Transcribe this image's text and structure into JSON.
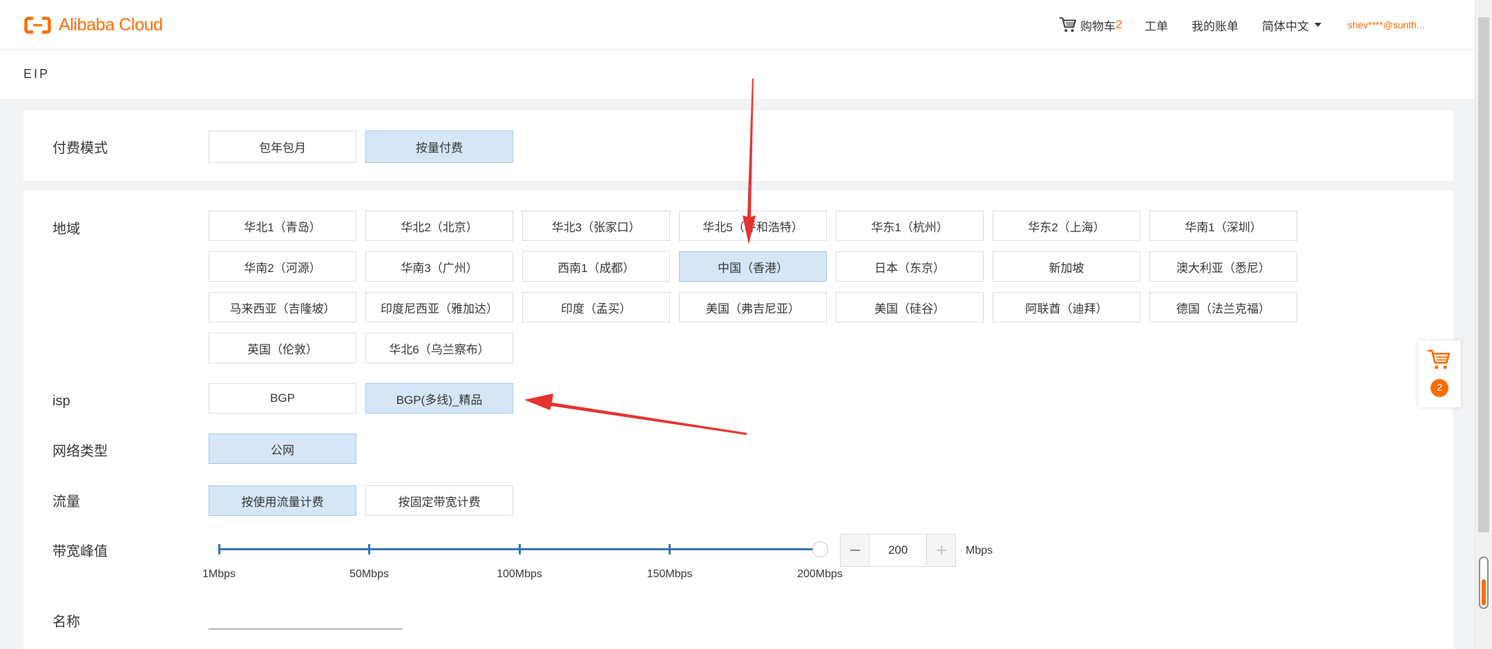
{
  "header": {
    "logo_text": "Alibaba Cloud",
    "cart_label": "购物车",
    "cart_count": "2",
    "ticket_label": "工单",
    "billing_label": "我的账单",
    "language_label": "简体中文",
    "user_label": "shev****@sunth..."
  },
  "page": {
    "title": "EIP"
  },
  "form": {
    "billing_mode": {
      "label": "付费模式",
      "options": [
        {
          "label": "包年包月",
          "selected": false
        },
        {
          "label": "按量付费",
          "selected": true
        }
      ]
    },
    "region": {
      "label": "地域",
      "options": [
        {
          "label": "华北1（青岛）",
          "selected": false
        },
        {
          "label": "华北2（北京）",
          "selected": false
        },
        {
          "label": "华北3（张家口）",
          "selected": false
        },
        {
          "label": "华北5（呼和浩特）",
          "selected": false
        },
        {
          "label": "华东1（杭州）",
          "selected": false
        },
        {
          "label": "华东2（上海）",
          "selected": false
        },
        {
          "label": "华南1（深圳）",
          "selected": false
        },
        {
          "label": "华南2（河源）",
          "selected": false
        },
        {
          "label": "华南3（广州）",
          "selected": false
        },
        {
          "label": "西南1（成都）",
          "selected": false
        },
        {
          "label": "中国（香港）",
          "selected": true
        },
        {
          "label": "日本（东京）",
          "selected": false
        },
        {
          "label": "新加坡",
          "selected": false
        },
        {
          "label": "澳大利亚（悉尼）",
          "selected": false
        },
        {
          "label": "马来西亚（吉隆坡）",
          "selected": false
        },
        {
          "label": "印度尼西亚（雅加达）",
          "selected": false
        },
        {
          "label": "印度（孟买）",
          "selected": false
        },
        {
          "label": "美国（弗吉尼亚）",
          "selected": false
        },
        {
          "label": "美国（硅谷）",
          "selected": false
        },
        {
          "label": "阿联酋（迪拜）",
          "selected": false
        },
        {
          "label": "德国（法兰克福）",
          "selected": false
        },
        {
          "label": "英国（伦敦）",
          "selected": false
        },
        {
          "label": "华北6（乌兰察布）",
          "selected": false
        }
      ]
    },
    "isp": {
      "label": "isp",
      "options": [
        {
          "label": "BGP",
          "selected": false
        },
        {
          "label": "BGP(多线)_精品",
          "selected": true
        }
      ]
    },
    "network_type": {
      "label": "网络类型",
      "options": [
        {
          "label": "公网",
          "selected": true
        }
      ]
    },
    "traffic": {
      "label": "流量",
      "options": [
        {
          "label": "按使用流量计费",
          "selected": true
        },
        {
          "label": "按固定带宽计费",
          "selected": false
        }
      ]
    },
    "bandwidth": {
      "label": "带宽峰值",
      "marks": [
        "1Mbps",
        "50Mbps",
        "100Mbps",
        "150Mbps",
        "200Mbps"
      ],
      "min": 1,
      "max": 200,
      "value": "200",
      "unit": "Mbps"
    },
    "name": {
      "label": "名称"
    }
  },
  "floating_cart": {
    "count": "2"
  },
  "icons": {
    "logo": "alibaba-cloud-logo-icon",
    "header_cart": "cart-icon",
    "language_dropdown": "caret-down-icon",
    "stepper_decrement": "minus-icon",
    "stepper_increment": "plus-icon",
    "floating_cart": "cart-icon"
  },
  "colors": {
    "brand": "#ff6a00",
    "selected_bg": "#d6e6f6",
    "selected_border": "#a7c4e2",
    "slider": "#2e73b8",
    "annotation": "#e5322d"
  }
}
